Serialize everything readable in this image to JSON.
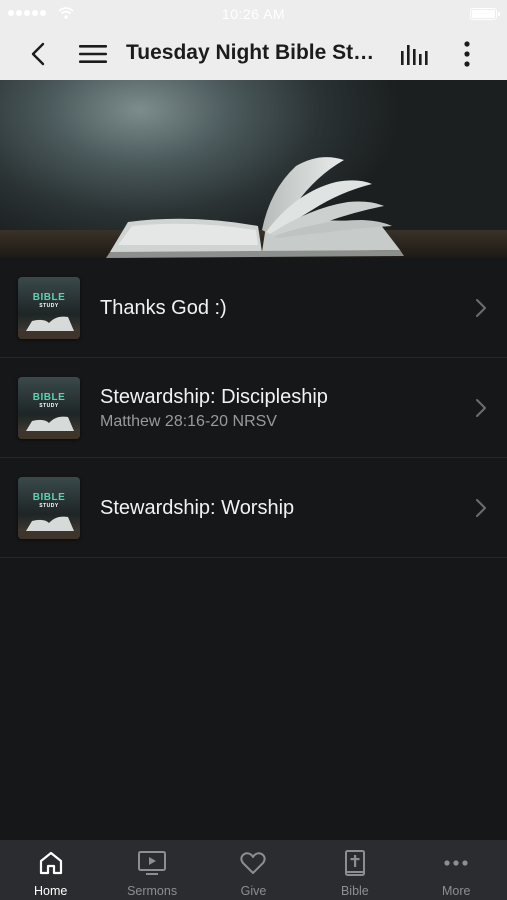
{
  "status_bar": {
    "time": "10:26 AM"
  },
  "nav": {
    "title": "Tuesday Night Bible Stu..."
  },
  "items": [
    {
      "title": "Thanks God :)",
      "subtitle": ""
    },
    {
      "title": "Stewardship: Discipleship",
      "subtitle": "Matthew 28:16-20 NRSV"
    },
    {
      "title": "Stewardship: Worship",
      "subtitle": ""
    }
  ],
  "thumbnail": {
    "word1": "BIBLE",
    "word2": "STUDY"
  },
  "tabs": [
    {
      "label": "Home",
      "icon": "home-icon",
      "active": true
    },
    {
      "label": "Sermons",
      "icon": "tv-play-icon",
      "active": false
    },
    {
      "label": "Give",
      "icon": "heart-icon",
      "active": false
    },
    {
      "label": "Bible",
      "icon": "bible-cross-icon",
      "active": false
    },
    {
      "label": "More",
      "icon": "dots-icon",
      "active": false
    }
  ],
  "colors": {
    "nav_bg": "#ededed",
    "list_bg": "#161719",
    "tab_bg": "#2b2c2f",
    "accent": "#5fd0b3"
  }
}
